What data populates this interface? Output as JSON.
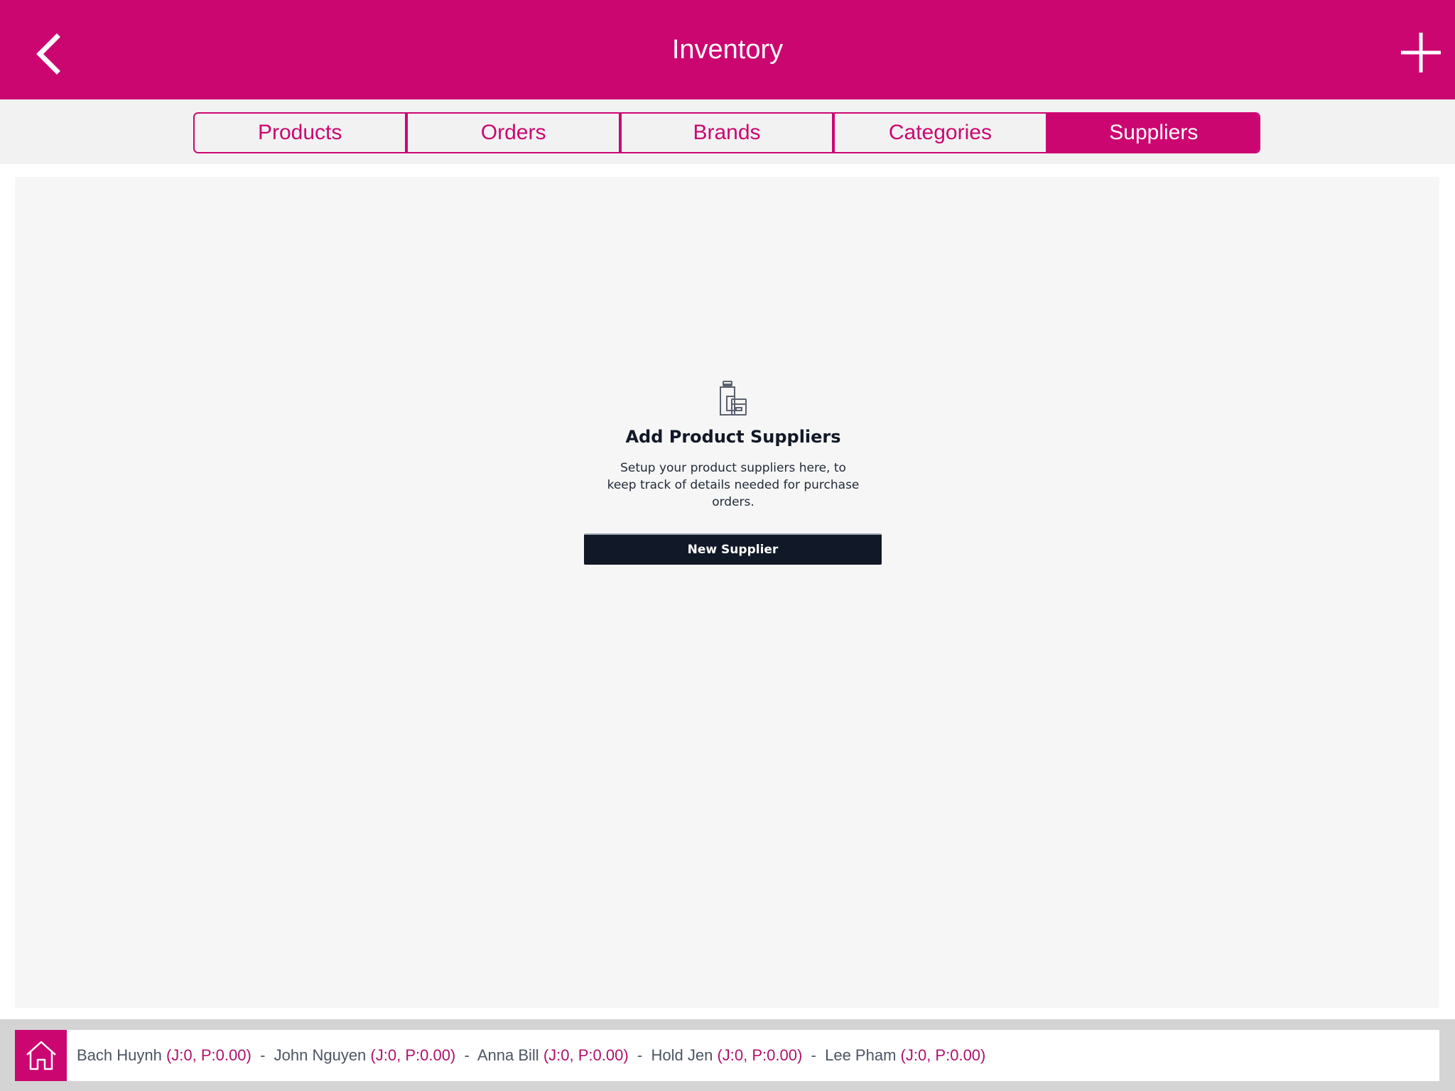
{
  "header": {
    "title": "Inventory",
    "back_icon": "chevron-left-icon",
    "add_icon": "plus-icon"
  },
  "tabs": [
    {
      "label": "Products",
      "selected": false
    },
    {
      "label": "Orders",
      "selected": false
    },
    {
      "label": "Brands",
      "selected": false
    },
    {
      "label": "Categories",
      "selected": false
    },
    {
      "label": "Suppliers",
      "selected": true
    }
  ],
  "empty_state": {
    "icon": "supplier-products-icon",
    "title": "Add Product Suppliers",
    "description": "Setup your product suppliers here, to keep track of details needed for purchase orders.",
    "button_label": "New Supplier"
  },
  "footer": {
    "home_icon": "home-icon",
    "staff": [
      {
        "name": "Bach Huynh",
        "stats": "(J:0, P:0.00)"
      },
      {
        "name": "John Nguyen",
        "stats": "(J:0, P:0.00)"
      },
      {
        "name": "Anna Bill",
        "stats": "(J:0, P:0.00)"
      },
      {
        "name": "Hold Jen",
        "stats": "(J:0, P:0.00)"
      },
      {
        "name": "Lee Pham",
        "stats": "(J:0, P:0.00)"
      }
    ],
    "separator": " - "
  },
  "colors": {
    "brand": "#cc0671",
    "tab_bar_bg": "#f2f2f2",
    "panel_bg": "#f6f6f6",
    "button_dark": "#111827",
    "footer_bg": "#d4d4d4"
  }
}
